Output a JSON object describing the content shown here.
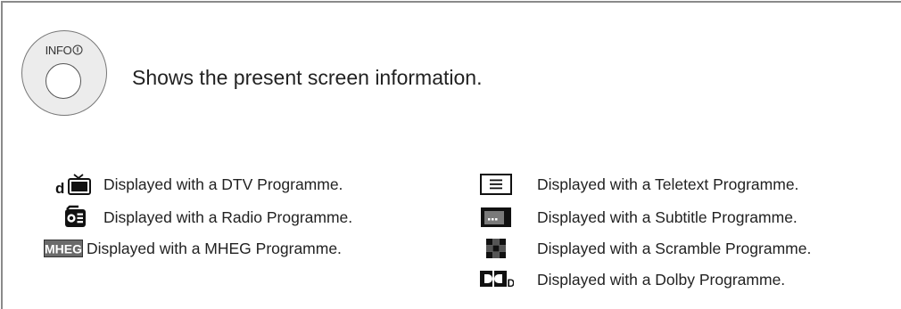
{
  "intro": {
    "button_label": "INFO",
    "text": "Shows the present screen information."
  },
  "left_items": [
    {
      "icon": "dtv-icon",
      "text": "Displayed with a DTV Programme."
    },
    {
      "icon": "radio-icon",
      "text": "Displayed with a Radio Programme."
    },
    {
      "icon": "mheg-icon",
      "icon_text": "MHEG",
      "text": "Displayed with a MHEG Programme."
    }
  ],
  "right_items": [
    {
      "icon": "teletext-icon",
      "text": "Displayed with a Teletext Programme."
    },
    {
      "icon": "subtitle-icon",
      "text": "Displayed with a Subtitle Programme."
    },
    {
      "icon": "scramble-icon",
      "text": "Displayed with a Scramble Programme."
    },
    {
      "icon": "dolby-icon",
      "text": "Displayed with a Dolby Programme."
    }
  ],
  "colors": {
    "frame": "#8a8a8a",
    "text": "#222222",
    "icon_dark": "#111111",
    "mheg_bg": "#6a6a6a"
  }
}
